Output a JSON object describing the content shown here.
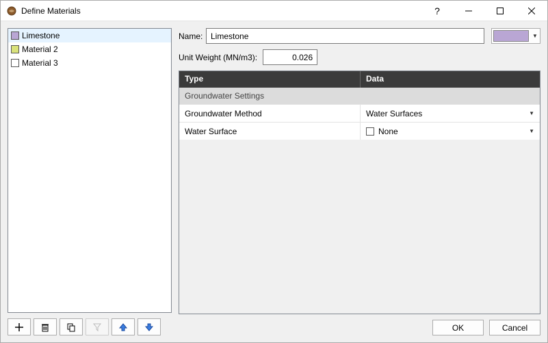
{
  "window": {
    "title": "Define Materials"
  },
  "materials": {
    "items": [
      {
        "label": "Limestone",
        "color": "#b9a6d4"
      },
      {
        "label": "Material 2",
        "color": "#d9e27b"
      },
      {
        "label": "Material 3",
        "color": "#ffffff"
      }
    ]
  },
  "form": {
    "name_label": "Name:",
    "name_value": "Limestone",
    "unit_weight_label": "Unit Weight (MN/m3):",
    "unit_weight_value": "0.026",
    "color_swatch": "#b9a6d4"
  },
  "grid": {
    "header_type": "Type",
    "header_data": "Data",
    "section_gw": "Groundwater Settings",
    "row_method_label": "Groundwater Method",
    "row_method_value": "Water Surfaces",
    "row_surface_label": "Water Surface",
    "row_surface_value": "None"
  },
  "buttons": {
    "ok": "OK",
    "cancel": "Cancel"
  }
}
